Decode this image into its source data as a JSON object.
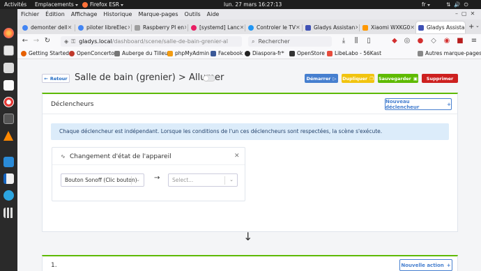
{
  "gnome": {
    "activities": "Activités",
    "places": "Emplacements",
    "app": "Firefox ESR",
    "clock": "lun. 27 mars  16:27:13",
    "lang": "fr"
  },
  "menubar": [
    "Fichier",
    "Édition",
    "Affichage",
    "Historique",
    "Marque-pages",
    "Outils",
    "Aide"
  ],
  "tabs": [
    {
      "label": "demonter dell",
      "color": "#4285f4"
    },
    {
      "label": "piloter libreElec",
      "color": "#4285f4"
    },
    {
      "label": "Raspberry PI en",
      "color": "#9e9e9e"
    },
    {
      "label": "[systemd] Lanc",
      "color": "#e91e63"
    },
    {
      "label": "Controler le TV",
      "color": "#2196f3"
    },
    {
      "label": "Gladys Assistan",
      "color": "#3f51b5"
    },
    {
      "label": "Xiaomi WXKG0",
      "color": "#ff9800"
    },
    {
      "label": "Gladys Assistan",
      "color": "#3f51b5"
    }
  ],
  "url": {
    "host": "gladys.local",
    "path": "/dashboard/scene/salle-de-bain-grenier-al"
  },
  "search_placeholder": "Rechercher",
  "bookmarks": [
    {
      "label": "Getting Started",
      "color": "#e66000"
    },
    {
      "label": "OpenConcerto",
      "color": "#c0392b"
    },
    {
      "label": "Auberge du Tilleul",
      "color": "#777"
    },
    {
      "label": "phpMyAdmin",
      "color": "#f39c12"
    },
    {
      "label": "Facebook",
      "color": "#3b5998"
    },
    {
      "label": "Diaspora-fr*",
      "color": "#222"
    },
    {
      "label": "OpenStore",
      "color": "#333"
    },
    {
      "label": "LibeLabo - 56Kast",
      "color": "#e74c3c"
    },
    {
      "label": "Autres marque-pages",
      "color": "#888"
    }
  ],
  "page": {
    "back": "Retour",
    "title": "Salle de bain (grenier) > Allumer",
    "enabled": false,
    "buttons": {
      "start": "Démarrer",
      "duplicate": "Dupliquer",
      "save": "Sauvegarder",
      "delete": "Supprimer"
    },
    "triggers": {
      "title": "Déclencheurs",
      "new_button": "Nouveau déclencheur",
      "info": "Chaque déclencheur est indépendant. Lorsque les conditions de l'un ces déclencheurs sont respectées, la scène s'exécute.",
      "item": {
        "title": "Changement d'état de l'appareil",
        "device": "Bouton Sonoff (Clic bouton)",
        "state_placeholder": "Select..."
      }
    },
    "action_group": {
      "title": "1.",
      "new_button": "Nouvelle action"
    }
  }
}
